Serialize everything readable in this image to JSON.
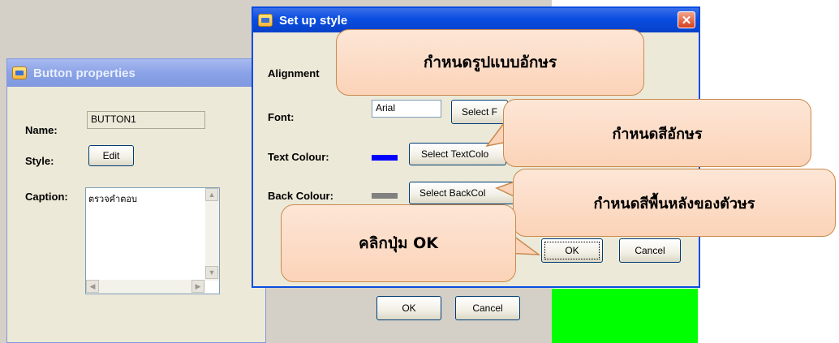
{
  "button_properties": {
    "title": "Button properties",
    "name_label": "Name:",
    "name_value": "BUTTON1",
    "style_label": "Style:",
    "edit_label": "Edit",
    "caption_label": "Caption:",
    "caption_value": "ตรวจคำตอบ",
    "ok_label": "OK",
    "cancel_label": "Cancel"
  },
  "setup_style": {
    "title": "Set up style",
    "alignment_label": "Alignment",
    "font_label": "Font:",
    "font_value": "Arial",
    "select_font_label": "Select F",
    "text_colour_label": "Text Colour:",
    "select_text_colour_label": "Select TextColo",
    "text_colour": "#0000ff",
    "back_colour_label": "Back Colour:",
    "select_back_colour_label": "Select BackCol",
    "back_colour": "#808080",
    "ok_label": "OK",
    "cancel_label": "Cancel"
  },
  "callouts": {
    "font_style": "กำหนดรูปแบบอักษร",
    "text_colour": "กำหนดสีอักษร",
    "back_colour": "กำหนดสีพื้นหลังของตัวษร",
    "click_ok": "คลิกปุ่ม OK"
  },
  "colors": {
    "xp_blue": "#0a4de0",
    "callout_fill": "#fbd3b8",
    "preview_green": "#00ff00"
  }
}
